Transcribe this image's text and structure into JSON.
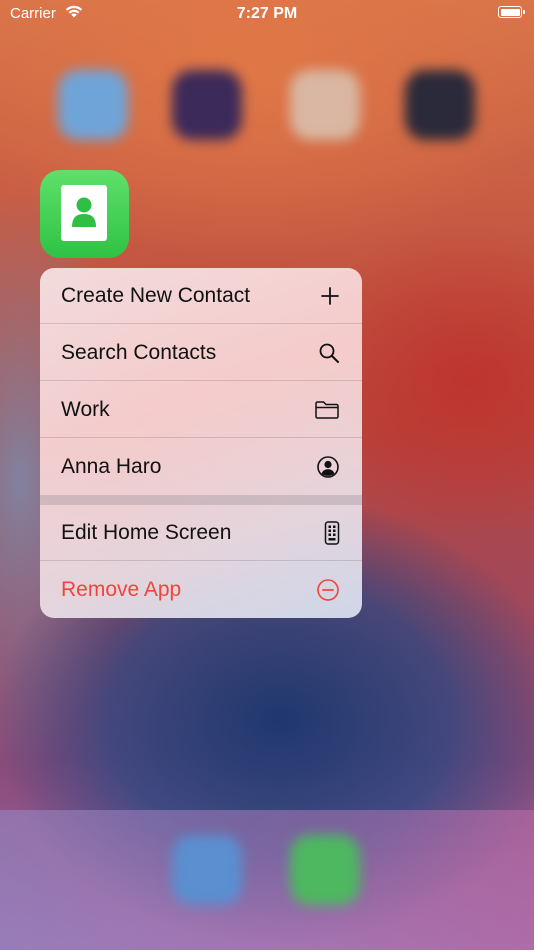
{
  "status_bar": {
    "carrier": "Carrier",
    "time": "7:27 PM",
    "wifi_icon": "wifi-icon",
    "battery_icon": "battery-icon"
  },
  "app_icon": {
    "name": "contacts-app-icon",
    "color": "#34c759"
  },
  "context_menu": {
    "items": [
      {
        "label": "Create New Contact",
        "icon": "plus-icon"
      },
      {
        "label": "Search Contacts",
        "icon": "search-icon"
      },
      {
        "label": "Work",
        "icon": "folder-icon"
      },
      {
        "label": "Anna Haro",
        "icon": "person-circle-icon"
      },
      {
        "label": "Edit Home Screen",
        "icon": "phone-apps-icon"
      },
      {
        "label": "Remove App",
        "icon": "minus-circle-icon",
        "color": "#f0453a"
      }
    ]
  }
}
